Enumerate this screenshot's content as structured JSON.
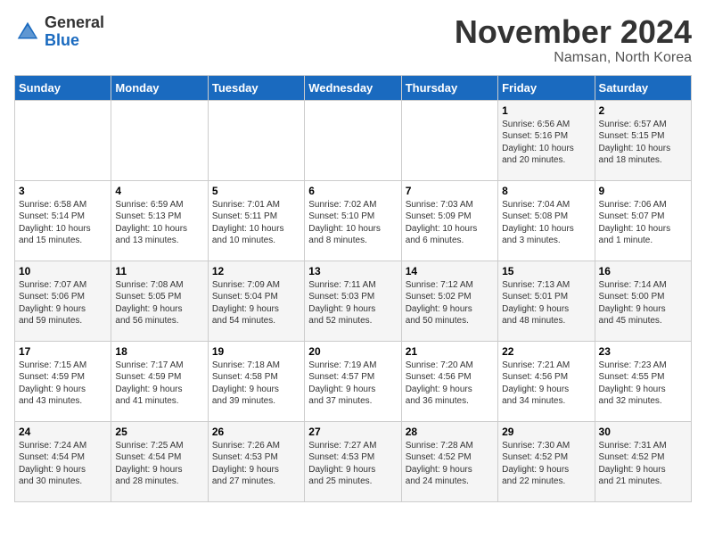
{
  "header": {
    "logo_general": "General",
    "logo_blue": "Blue",
    "month_title": "November 2024",
    "location": "Namsan, North Korea"
  },
  "weekdays": [
    "Sunday",
    "Monday",
    "Tuesday",
    "Wednesday",
    "Thursday",
    "Friday",
    "Saturday"
  ],
  "weeks": [
    [
      {
        "day": "",
        "info": ""
      },
      {
        "day": "",
        "info": ""
      },
      {
        "day": "",
        "info": ""
      },
      {
        "day": "",
        "info": ""
      },
      {
        "day": "",
        "info": ""
      },
      {
        "day": "1",
        "info": "Sunrise: 6:56 AM\nSunset: 5:16 PM\nDaylight: 10 hours\nand 20 minutes."
      },
      {
        "day": "2",
        "info": "Sunrise: 6:57 AM\nSunset: 5:15 PM\nDaylight: 10 hours\nand 18 minutes."
      }
    ],
    [
      {
        "day": "3",
        "info": "Sunrise: 6:58 AM\nSunset: 5:14 PM\nDaylight: 10 hours\nand 15 minutes."
      },
      {
        "day": "4",
        "info": "Sunrise: 6:59 AM\nSunset: 5:13 PM\nDaylight: 10 hours\nand 13 minutes."
      },
      {
        "day": "5",
        "info": "Sunrise: 7:01 AM\nSunset: 5:11 PM\nDaylight: 10 hours\nand 10 minutes."
      },
      {
        "day": "6",
        "info": "Sunrise: 7:02 AM\nSunset: 5:10 PM\nDaylight: 10 hours\nand 8 minutes."
      },
      {
        "day": "7",
        "info": "Sunrise: 7:03 AM\nSunset: 5:09 PM\nDaylight: 10 hours\nand 6 minutes."
      },
      {
        "day": "8",
        "info": "Sunrise: 7:04 AM\nSunset: 5:08 PM\nDaylight: 10 hours\nand 3 minutes."
      },
      {
        "day": "9",
        "info": "Sunrise: 7:06 AM\nSunset: 5:07 PM\nDaylight: 10 hours\nand 1 minute."
      }
    ],
    [
      {
        "day": "10",
        "info": "Sunrise: 7:07 AM\nSunset: 5:06 PM\nDaylight: 9 hours\nand 59 minutes."
      },
      {
        "day": "11",
        "info": "Sunrise: 7:08 AM\nSunset: 5:05 PM\nDaylight: 9 hours\nand 56 minutes."
      },
      {
        "day": "12",
        "info": "Sunrise: 7:09 AM\nSunset: 5:04 PM\nDaylight: 9 hours\nand 54 minutes."
      },
      {
        "day": "13",
        "info": "Sunrise: 7:11 AM\nSunset: 5:03 PM\nDaylight: 9 hours\nand 52 minutes."
      },
      {
        "day": "14",
        "info": "Sunrise: 7:12 AM\nSunset: 5:02 PM\nDaylight: 9 hours\nand 50 minutes."
      },
      {
        "day": "15",
        "info": "Sunrise: 7:13 AM\nSunset: 5:01 PM\nDaylight: 9 hours\nand 48 minutes."
      },
      {
        "day": "16",
        "info": "Sunrise: 7:14 AM\nSunset: 5:00 PM\nDaylight: 9 hours\nand 45 minutes."
      }
    ],
    [
      {
        "day": "17",
        "info": "Sunrise: 7:15 AM\nSunset: 4:59 PM\nDaylight: 9 hours\nand 43 minutes."
      },
      {
        "day": "18",
        "info": "Sunrise: 7:17 AM\nSunset: 4:59 PM\nDaylight: 9 hours\nand 41 minutes."
      },
      {
        "day": "19",
        "info": "Sunrise: 7:18 AM\nSunset: 4:58 PM\nDaylight: 9 hours\nand 39 minutes."
      },
      {
        "day": "20",
        "info": "Sunrise: 7:19 AM\nSunset: 4:57 PM\nDaylight: 9 hours\nand 37 minutes."
      },
      {
        "day": "21",
        "info": "Sunrise: 7:20 AM\nSunset: 4:56 PM\nDaylight: 9 hours\nand 36 minutes."
      },
      {
        "day": "22",
        "info": "Sunrise: 7:21 AM\nSunset: 4:56 PM\nDaylight: 9 hours\nand 34 minutes."
      },
      {
        "day": "23",
        "info": "Sunrise: 7:23 AM\nSunset: 4:55 PM\nDaylight: 9 hours\nand 32 minutes."
      }
    ],
    [
      {
        "day": "24",
        "info": "Sunrise: 7:24 AM\nSunset: 4:54 PM\nDaylight: 9 hours\nand 30 minutes."
      },
      {
        "day": "25",
        "info": "Sunrise: 7:25 AM\nSunset: 4:54 PM\nDaylight: 9 hours\nand 28 minutes."
      },
      {
        "day": "26",
        "info": "Sunrise: 7:26 AM\nSunset: 4:53 PM\nDaylight: 9 hours\nand 27 minutes."
      },
      {
        "day": "27",
        "info": "Sunrise: 7:27 AM\nSunset: 4:53 PM\nDaylight: 9 hours\nand 25 minutes."
      },
      {
        "day": "28",
        "info": "Sunrise: 7:28 AM\nSunset: 4:52 PM\nDaylight: 9 hours\nand 24 minutes."
      },
      {
        "day": "29",
        "info": "Sunrise: 7:30 AM\nSunset: 4:52 PM\nDaylight: 9 hours\nand 22 minutes."
      },
      {
        "day": "30",
        "info": "Sunrise: 7:31 AM\nSunset: 4:52 PM\nDaylight: 9 hours\nand 21 minutes."
      }
    ]
  ]
}
